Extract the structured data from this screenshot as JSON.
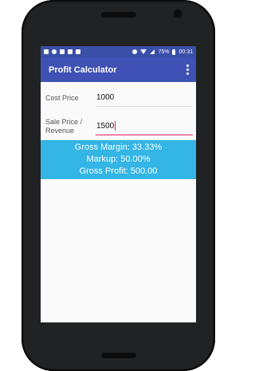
{
  "status_bar": {
    "battery": "75%",
    "time": "00:31"
  },
  "app_bar": {
    "title": "Profit Calculator",
    "overflow_icon": "more-vert-icon"
  },
  "form": {
    "cost_label": "Cost Price",
    "cost_value": "1000",
    "sale_label_line1": "Sale Price /",
    "sale_label_line2": "Revenue",
    "sale_value": "1500"
  },
  "results": {
    "gross_margin": "Gross Margin: 33.33%",
    "markup": "Markup: 50.00%",
    "gross_profit": "Gross Profit: 500.00"
  },
  "colors": {
    "status_bar": "#3a4fa8",
    "app_bar": "#3f51b5",
    "result_panel": "#33b5e5",
    "accent": "#e91e63"
  }
}
